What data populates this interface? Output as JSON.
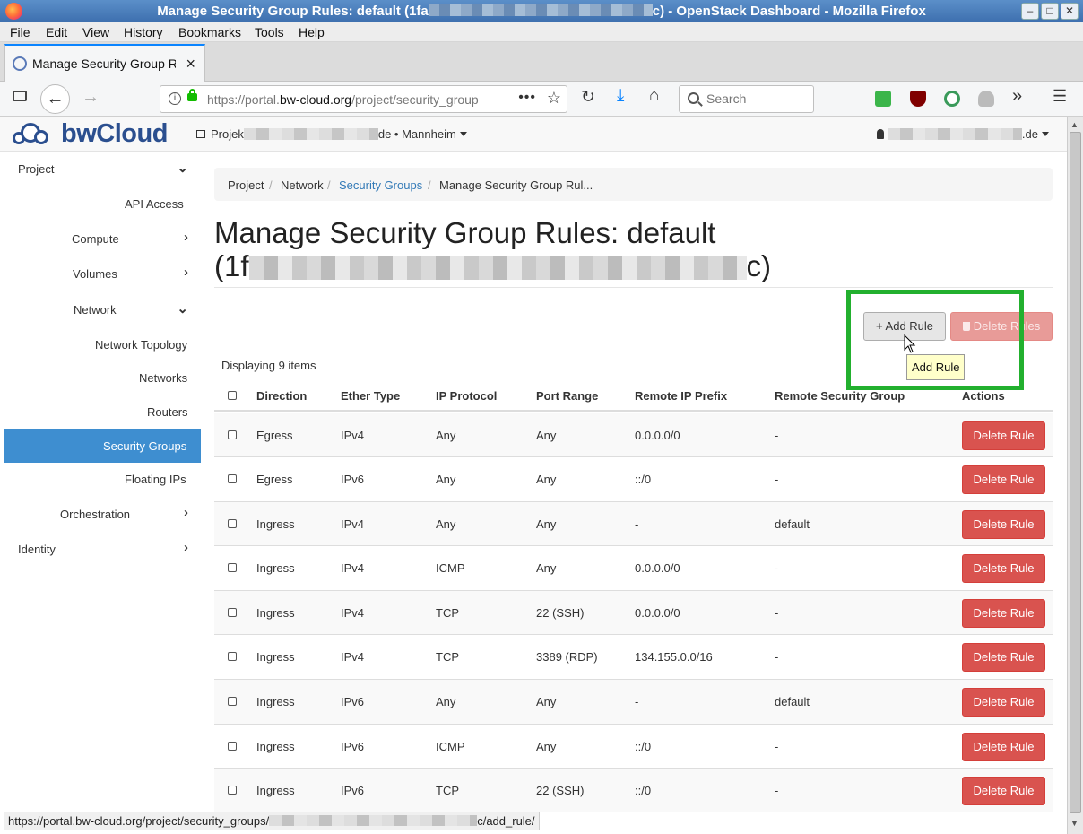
{
  "window": {
    "title_prefix": "Manage Security Group Rules: default (1fa",
    "title_suffix": "c) - OpenStack Dashboard - Mozilla Firefox",
    "minimize": "–",
    "maximize": "□",
    "close": "✕"
  },
  "menu": [
    "File",
    "Edit",
    "View",
    "History",
    "Bookmarks",
    "Tools",
    "Help"
  ],
  "tab": {
    "label": "Manage Security Group Ru",
    "close": "×"
  },
  "nav": {
    "url_prefix": "https://portal.",
    "url_domain": "bw-cloud.org",
    "url_suffix": "/project/security_group",
    "page_actions": "•••",
    "search_placeholder": "Search"
  },
  "header": {
    "brand": "bwCloud",
    "project_prefix": "Projek",
    "project_suffix": "de • Mannheim",
    "user_suffix": ".de"
  },
  "sidebar": {
    "items": [
      {
        "label": "Project",
        "chevron": "⌄"
      },
      {
        "label": "API Access",
        "chevron": ""
      },
      {
        "label": "Compute",
        "chevron": "›"
      },
      {
        "label": "Volumes",
        "chevron": "›"
      },
      {
        "label": "Network",
        "chevron": "⌄"
      },
      {
        "label": "Network Topology",
        "chevron": ""
      },
      {
        "label": "Networks",
        "chevron": ""
      },
      {
        "label": "Routers",
        "chevron": ""
      },
      {
        "label": "Security Groups",
        "chevron": ""
      },
      {
        "label": "Floating IPs",
        "chevron": ""
      },
      {
        "label": "Orchestration",
        "chevron": "›"
      },
      {
        "label": "Identity",
        "chevron": "›"
      }
    ]
  },
  "breadcrumb": {
    "project": "Project",
    "network": "Network",
    "security_groups": "Security Groups",
    "current": "Manage Security Group Rul...",
    "sep": "/"
  },
  "page": {
    "heading_line1": "Manage Security Group Rules: default",
    "heading_open": "(1f",
    "heading_close": "c)",
    "add_rule": "Add Rule",
    "delete_rules": "Delete Rules",
    "tooltip": "Add Rule",
    "displaying": "Displaying 9 items"
  },
  "table": {
    "columns": [
      "Direction",
      "Ether Type",
      "IP Protocol",
      "Port Range",
      "Remote IP Prefix",
      "Remote Security Group",
      "Actions"
    ],
    "action_label": "Delete Rule",
    "rows": [
      [
        "Egress",
        "IPv4",
        "Any",
        "Any",
        "0.0.0.0/0",
        "-"
      ],
      [
        "Egress",
        "IPv6",
        "Any",
        "Any",
        "::/0",
        "-"
      ],
      [
        "Ingress",
        "IPv4",
        "Any",
        "Any",
        "-",
        "default"
      ],
      [
        "Ingress",
        "IPv4",
        "ICMP",
        "Any",
        "0.0.0.0/0",
        "-"
      ],
      [
        "Ingress",
        "IPv4",
        "TCP",
        "22 (SSH)",
        "0.0.0.0/0",
        "-"
      ],
      [
        "Ingress",
        "IPv4",
        "TCP",
        "3389 (RDP)",
        "134.155.0.0/16",
        "-"
      ],
      [
        "Ingress",
        "IPv6",
        "Any",
        "Any",
        "-",
        "default"
      ],
      [
        "Ingress",
        "IPv6",
        "ICMP",
        "Any",
        "::/0",
        "-"
      ],
      [
        "Ingress",
        "IPv6",
        "TCP",
        "22 (SSH)",
        "::/0",
        "-"
      ]
    ]
  },
  "status": {
    "prefix": "https://portal.bw-cloud.org/project/security_groups/",
    "suffix": "c/add_rule/"
  },
  "colors": {
    "accent": "#3e8ed0",
    "danger": "#d9534f",
    "highlight": "#22b02e",
    "tooltip_bg": "#ffffca"
  }
}
